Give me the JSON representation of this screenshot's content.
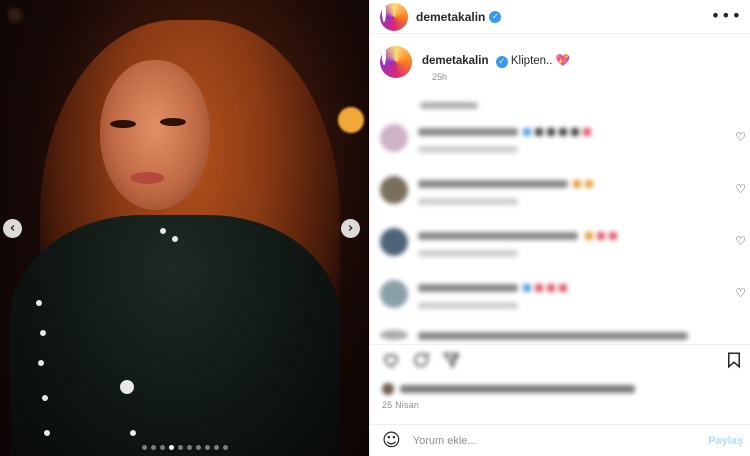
{
  "post": {
    "username": "demetakalin",
    "verified": true,
    "caption_text": "Klipten..",
    "caption_emoji": "💖",
    "caption_time": "25h",
    "date": "25 Nisan"
  },
  "header": {
    "more_label": "•••"
  },
  "media": {
    "prev_label": "‹",
    "next_label": "›",
    "slide_count": 10,
    "active_slide": 3
  },
  "actions": {
    "like_icon": "heart-icon",
    "comment_icon": "comment-icon",
    "share_icon": "share-icon",
    "save_icon": "bookmark-icon"
  },
  "composer": {
    "emoji_icon": "☺",
    "placeholder": "Yorum ekle...",
    "post_label": "Paylaş"
  },
  "colors": {
    "accent": "#3897f0",
    "muted": "#8e8e8e",
    "post_disabled": "#b2dffc"
  }
}
